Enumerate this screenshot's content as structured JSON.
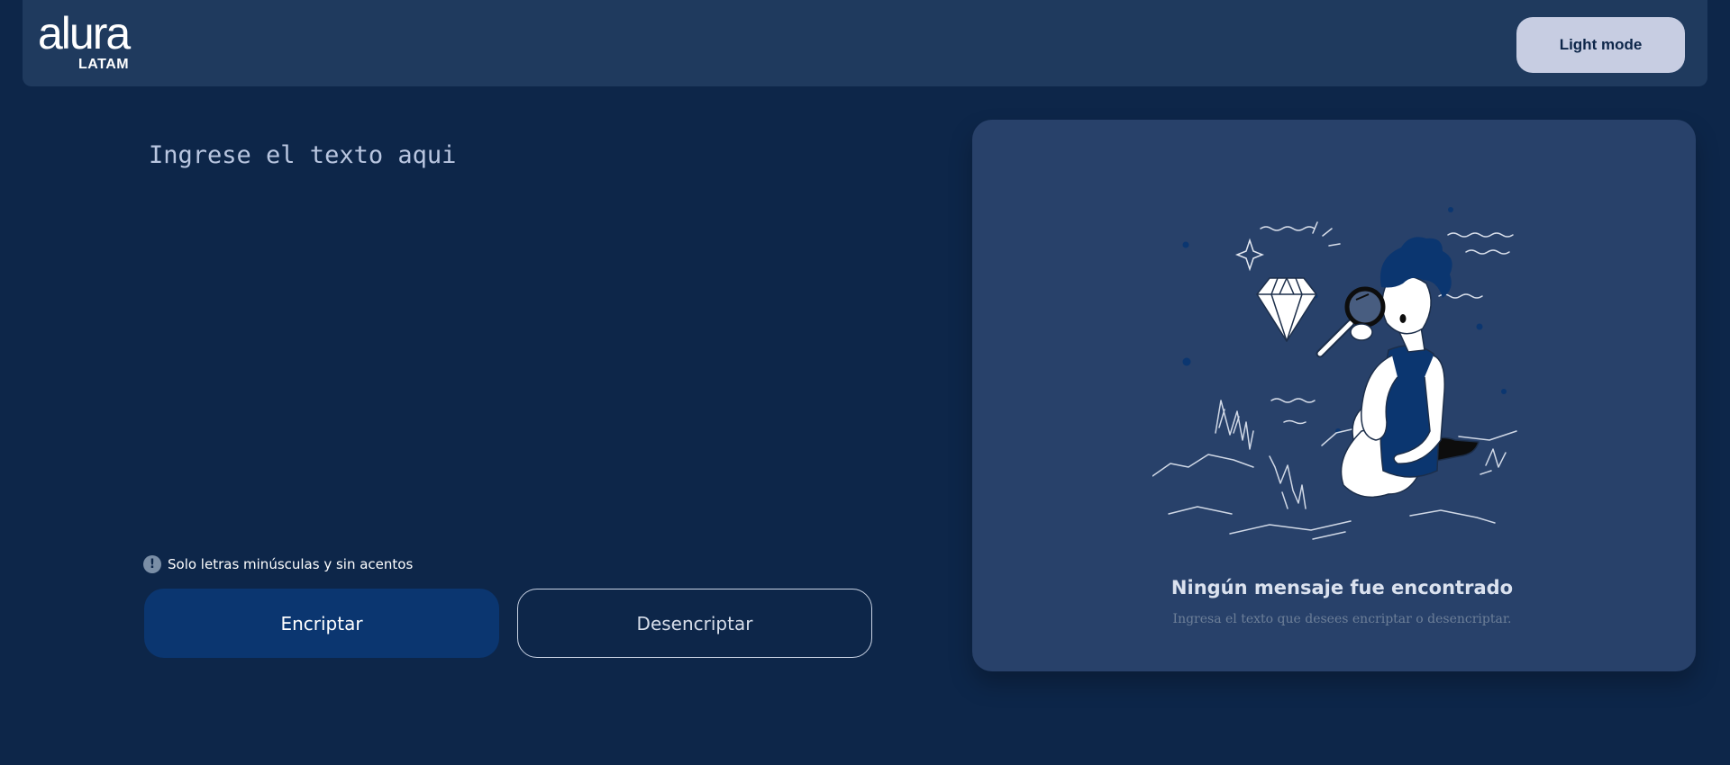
{
  "header": {
    "logo_main": "alura",
    "logo_sub": "LATAM",
    "mode_button_label": "Light mode"
  },
  "input": {
    "placeholder": "Ingrese el texto aqui"
  },
  "hint": {
    "icon": "exclamation-icon",
    "text": "Solo letras minúsculas y sin acentos"
  },
  "buttons": {
    "encrypt_label": "Encriptar",
    "decrypt_label": "Desencriptar"
  },
  "result_panel": {
    "illustration": "person-magnifying-glass-diamond-illustration",
    "title": "Ningún mensaje fue encontrado",
    "subtitle": "Ingresa el texto que desees encriptar o desencriptar."
  },
  "colors": {
    "background": "#0d2649",
    "header": "#1f3a5e",
    "panel": "#28416a",
    "primary_button": "#0b3670",
    "mode_button": "#c7cde2"
  }
}
